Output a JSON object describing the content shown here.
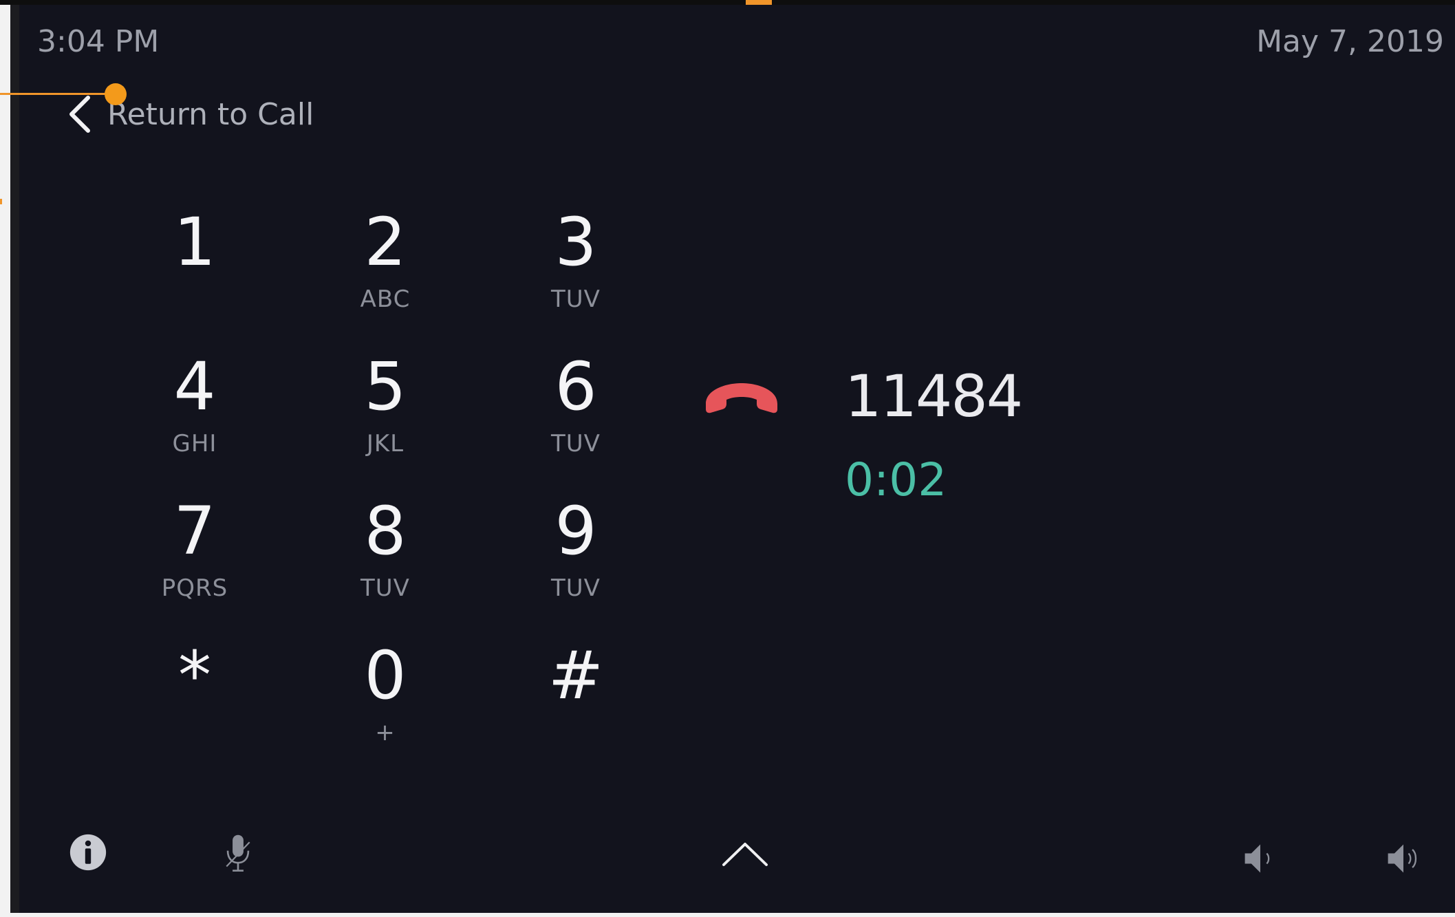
{
  "status_bar": {
    "time": "3:04 PM",
    "date": "May 7, 2019"
  },
  "nav": {
    "return_label": "Return to Call",
    "back_icon": "chevron-left-icon"
  },
  "keypad": {
    "keys": [
      {
        "digit": "1",
        "letters": ""
      },
      {
        "digit": "2",
        "letters": "ABC"
      },
      {
        "digit": "3",
        "letters": "TUV"
      },
      {
        "digit": "4",
        "letters": "GHI"
      },
      {
        "digit": "5",
        "letters": "JKL"
      },
      {
        "digit": "6",
        "letters": "TUV"
      },
      {
        "digit": "7",
        "letters": "PQRS"
      },
      {
        "digit": "8",
        "letters": "TUV"
      },
      {
        "digit": "9",
        "letters": "TUV"
      },
      {
        "digit": "*",
        "letters": ""
      },
      {
        "digit": "0",
        "letters": "+"
      },
      {
        "digit": "#",
        "letters": ""
      }
    ]
  },
  "call": {
    "number": "11484",
    "duration": "0:02",
    "hangup_icon": "hang-up-phone-icon"
  },
  "toolbar": {
    "icons": [
      "info-icon",
      "microphone-icon",
      "chevron-up-icon",
      "volume-down-icon",
      "volume-up-icon"
    ]
  },
  "colors": {
    "background": "#12131d",
    "accent_annotation": "#f39a1b",
    "timer": "#4bbfa6",
    "hangup": "#e6555a"
  }
}
